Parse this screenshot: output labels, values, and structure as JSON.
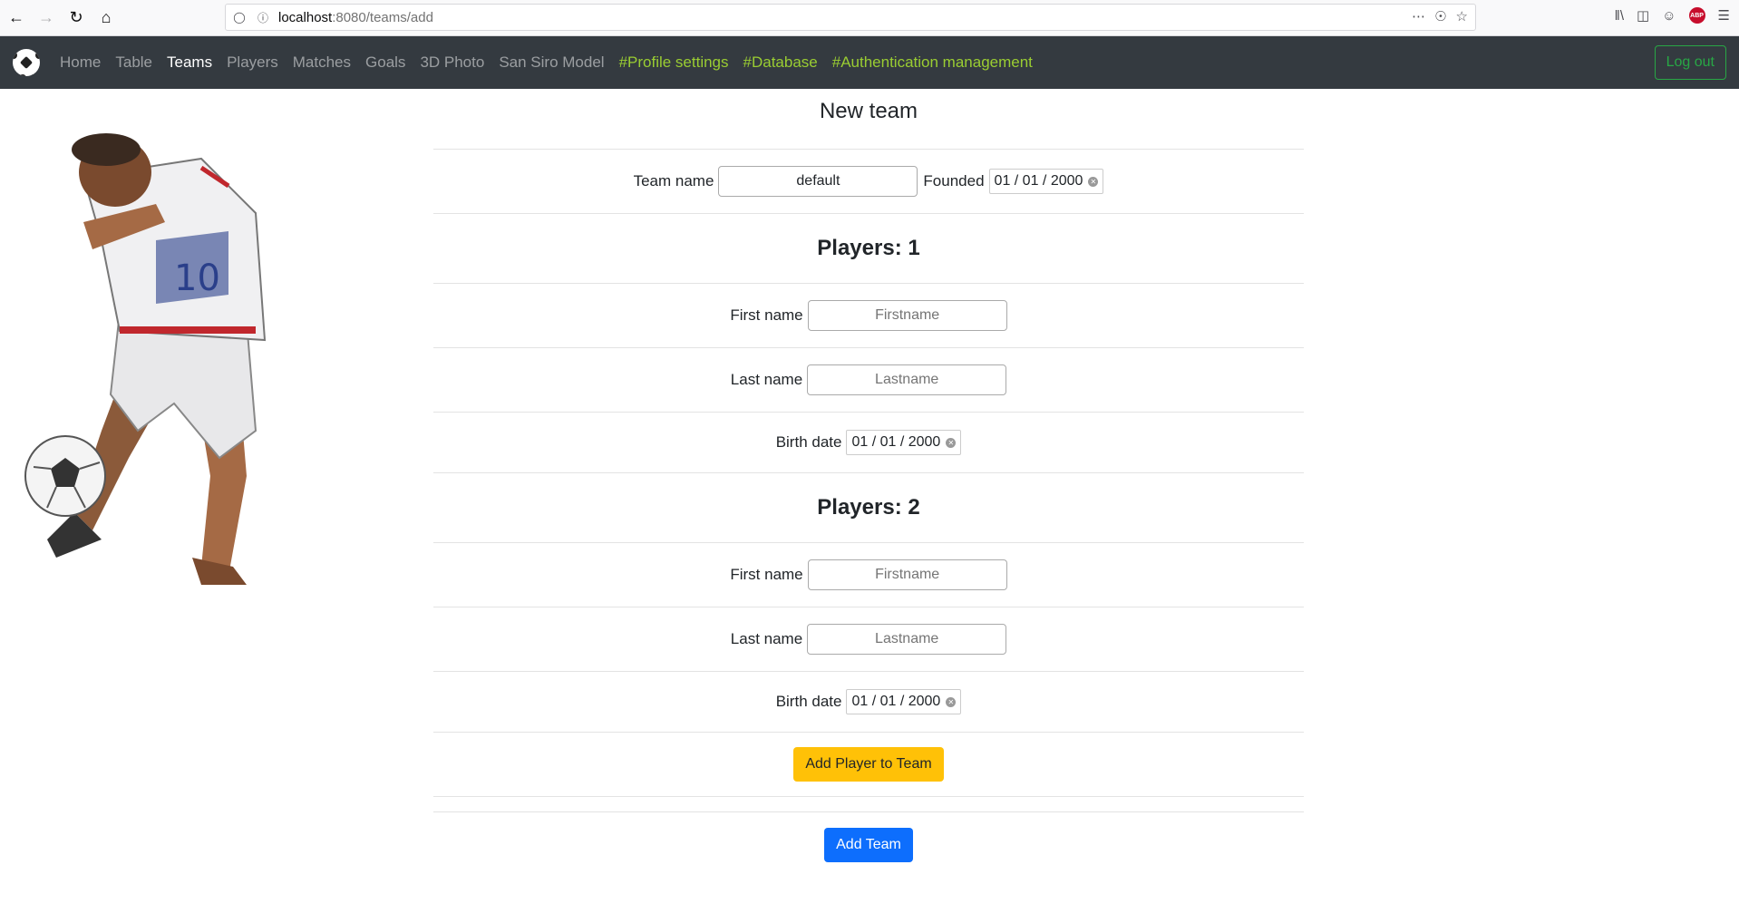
{
  "browser": {
    "url_host": "localhost",
    "url_rest": ":8080/teams/add"
  },
  "navbar": {
    "items": [
      {
        "label": "Home"
      },
      {
        "label": "Table"
      },
      {
        "label": "Teams"
      },
      {
        "label": "Players"
      },
      {
        "label": "Matches"
      },
      {
        "label": "Goals"
      },
      {
        "label": "3D Photo"
      },
      {
        "label": "San Siro Model"
      },
      {
        "label": "#Profile settings"
      },
      {
        "label": "#Database"
      },
      {
        "label": "#Authentication management"
      }
    ],
    "logout_label": "Log out"
  },
  "form": {
    "title": "New team",
    "team_name_label": "Team name",
    "team_name_value": "default",
    "founded_label": "Founded",
    "founded_value": "01 / 01 / 2000",
    "players": [
      {
        "heading": "Players: 1",
        "first_name_label": "First name",
        "first_name_placeholder": "Firstname",
        "last_name_label": "Last name",
        "last_name_placeholder": "Lastname",
        "birth_date_label": "Birth date",
        "birth_date_value": "01 / 01 / 2000"
      },
      {
        "heading": "Players: 2",
        "first_name_label": "First name",
        "first_name_placeholder": "Firstname",
        "last_name_label": "Last name",
        "last_name_placeholder": "Lastname",
        "birth_date_label": "Birth date",
        "birth_date_value": "01 / 01 / 2000"
      }
    ],
    "add_player_label": "Add Player to Team",
    "add_team_label": "Add Team"
  },
  "colors": {
    "navbar_bg": "#343a40",
    "green_link": "#9acd32",
    "warning": "#ffc107",
    "primary": "#0d6efd"
  }
}
